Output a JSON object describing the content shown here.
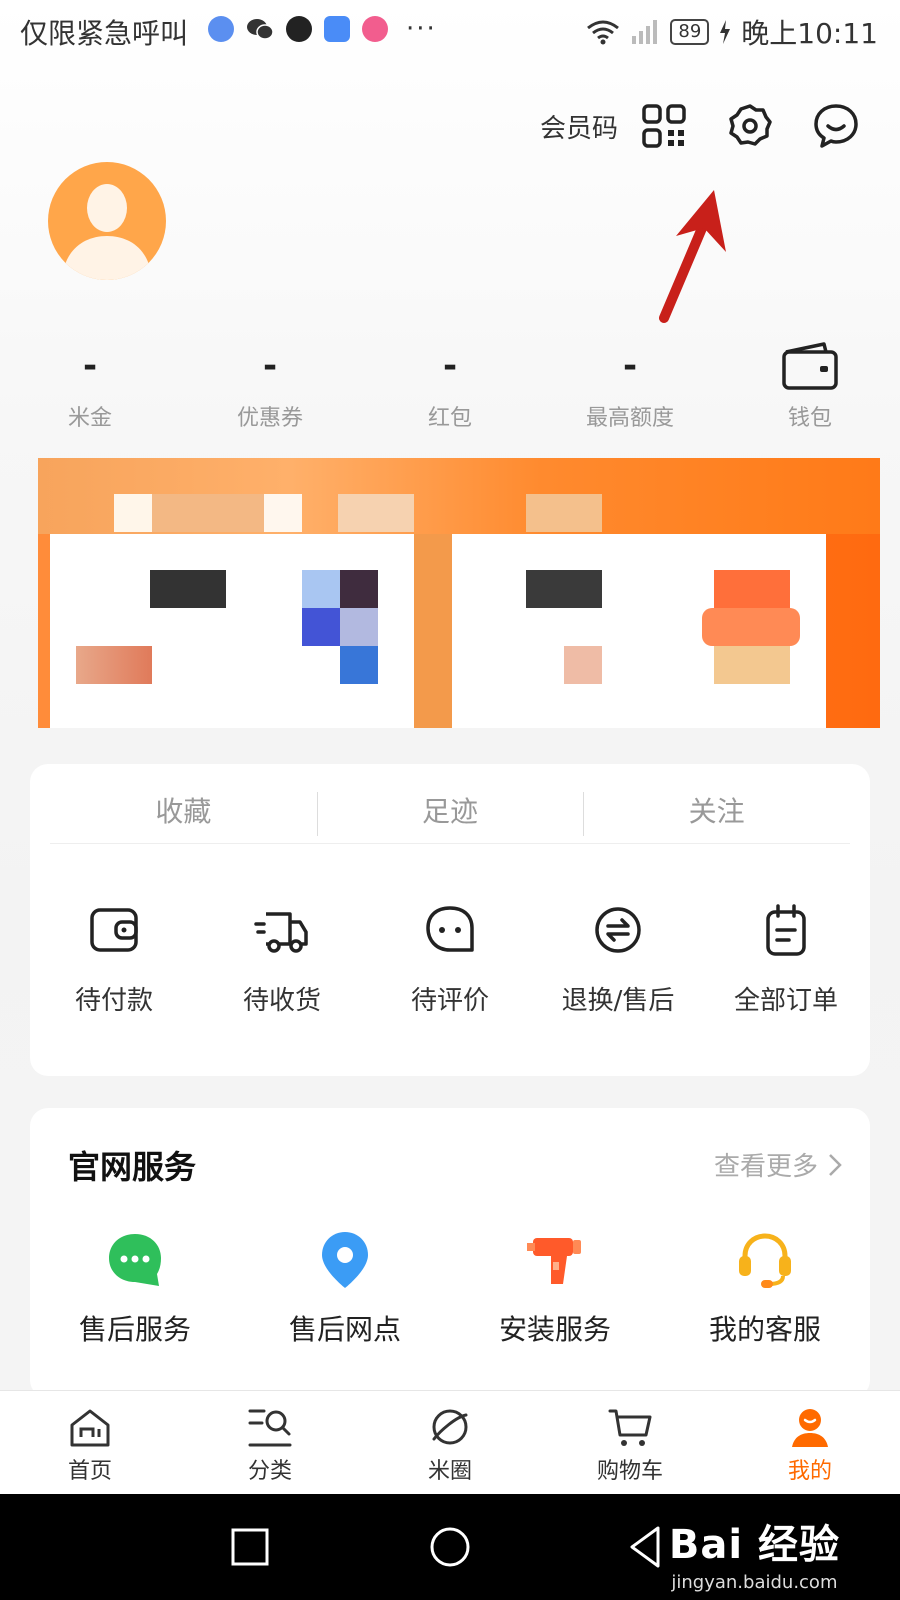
{
  "status_bar": {
    "emergency_text": "仅限紧急呼叫",
    "more": "···",
    "battery": "89",
    "time": "晚上10:11"
  },
  "header": {
    "member_code_label": "会员码"
  },
  "stats": [
    {
      "value": "-",
      "label": "米金"
    },
    {
      "value": "-",
      "label": "优惠券"
    },
    {
      "value": "-",
      "label": "红包"
    },
    {
      "value": "-",
      "label": "最高额度"
    },
    {
      "label": "钱包"
    }
  ],
  "order_tabs": [
    "收藏",
    "足迹",
    "关注"
  ],
  "orders": [
    {
      "label": "待付款",
      "icon": "wallet-icon"
    },
    {
      "label": "待收货",
      "icon": "delivery-truck-icon"
    },
    {
      "label": "待评价",
      "icon": "review-chat-icon"
    },
    {
      "label": "退换/售后",
      "icon": "exchange-icon"
    },
    {
      "label": "全部订单",
      "icon": "clipboard-icon"
    }
  ],
  "services": {
    "title": "官网服务",
    "more_label": "查看更多",
    "items": [
      {
        "label": "售后服务",
        "icon": "chat-bubble-icon",
        "color": "#2fbf5b"
      },
      {
        "label": "售后网点",
        "icon": "location-pin-icon",
        "color": "#3b9cf5"
      },
      {
        "label": "安装服务",
        "icon": "drill-icon",
        "color": "#ff5a2a"
      },
      {
        "label": "我的客服",
        "icon": "headset-icon",
        "color": "#f7b21b"
      }
    ]
  },
  "tabbar": [
    {
      "label": "首页",
      "icon": "home-icon"
    },
    {
      "label": "分类",
      "icon": "category-search-icon"
    },
    {
      "label": "米圈",
      "icon": "planet-icon"
    },
    {
      "label": "购物车",
      "icon": "cart-icon"
    },
    {
      "label": "我的",
      "icon": "profile-icon",
      "active": true
    }
  ],
  "colors": {
    "accent": "#ff6a00",
    "annotation_arrow": "#c8201a"
  },
  "watermark": {
    "main": "Bai 经验",
    "sub": "jingyan.baidu.com"
  }
}
